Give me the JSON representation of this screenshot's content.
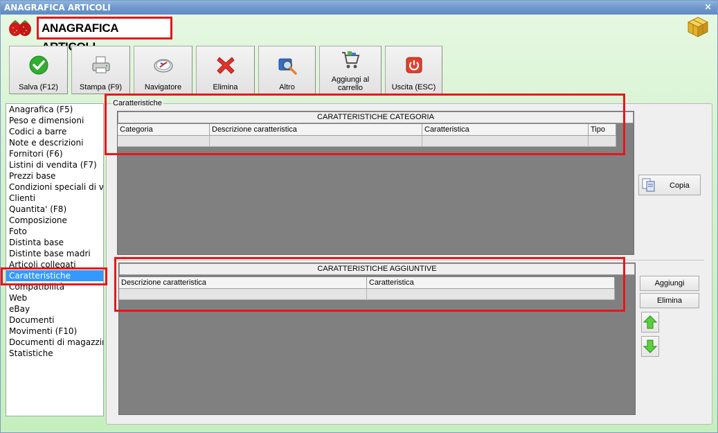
{
  "window": {
    "title": "ANAGRAFICA ARTICOLI",
    "close_glyph": "×"
  },
  "header": {
    "title": "ANAGRAFICA ARTICOLI"
  },
  "toolbar": [
    {
      "id": "save",
      "label": "Salva (F12)",
      "icon": "check-icon"
    },
    {
      "id": "print",
      "label": "Stampa (F9)",
      "icon": "printer-icon"
    },
    {
      "id": "navigator",
      "label": "Navigatore",
      "icon": "compass-icon"
    },
    {
      "id": "delete",
      "label": "Elimina",
      "icon": "red-x-icon"
    },
    {
      "id": "other",
      "label": "Altro",
      "icon": "magnifier-icon"
    },
    {
      "id": "cart",
      "label": "Aggiungi al carrello",
      "icon": "cart-icon"
    },
    {
      "id": "exit",
      "label": "Uscita (ESC)",
      "icon": "power-icon"
    }
  ],
  "sidebar": {
    "items": [
      "Anagrafica (F5)",
      "Peso e dimensioni",
      "Codici a barre",
      "Note e descrizioni",
      "Fornitori (F6)",
      "Listini di vendita (F7)",
      "Prezzi base",
      "Condizioni speciali di ve",
      "Clienti",
      "Quantita' (F8)",
      "Composizione",
      "Foto",
      "Distinta base",
      "Distinte base madri",
      "Articoli collegati",
      "Caratteristiche",
      "Compatibilità",
      "Web",
      "eBay",
      "Documenti",
      "Movimenti (F10)",
      "Documenti di magazzino",
      "Statistiche"
    ],
    "selected_index": 15
  },
  "panel": {
    "caption": "Caratteristiche",
    "category_grid": {
      "band": "CARATTERISTICHE CATEGORIA",
      "columns": [
        "Categoria",
        "Descrizione caratteristica",
        "Caratteristica",
        "Tipo"
      ]
    },
    "copy_button": "Copia",
    "additional_grid": {
      "band": "CARATTERISTICHE AGGIUNTIVE",
      "columns": [
        "Descrizione caratteristica",
        "Caratteristica"
      ]
    },
    "add_button": "Aggiungi",
    "delete_button": "Elimina"
  },
  "colors": {
    "highlight": "#e8151b",
    "selection": "#3399ff",
    "grid_bg": "#808080"
  }
}
